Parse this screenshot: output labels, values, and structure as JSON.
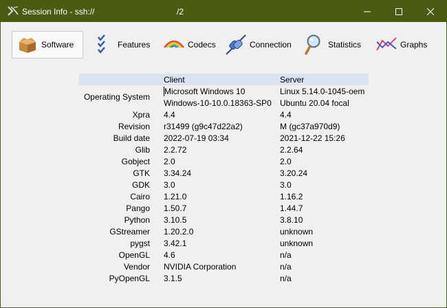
{
  "window": {
    "title": "Session Info - ssh://",
    "title_suffix": "/2",
    "controls": {
      "minimize": "minimize",
      "maximize": "maximize",
      "close": "close"
    }
  },
  "toolbar": {
    "items": [
      {
        "label": "Software",
        "icon": "box-icon",
        "active": true
      },
      {
        "label": "Features",
        "icon": "checklist-icon",
        "active": false
      },
      {
        "label": "Codecs",
        "icon": "rainbow-icon",
        "active": false
      },
      {
        "label": "Connection",
        "icon": "plug-icon",
        "active": false
      },
      {
        "label": "Statistics",
        "icon": "magnifier-icon",
        "active": false
      },
      {
        "label": "Graphs",
        "icon": "line-graph-icon",
        "active": false
      }
    ]
  },
  "table": {
    "headers": {
      "client": "Client",
      "server": "Server"
    },
    "rows": [
      {
        "label": "Operating System",
        "client": "Microsoft Windows 10",
        "client2": "Windows-10-10.0.18363-SP0",
        "server": "Linux 5.14.0-1045-oem",
        "server2": "Ubuntu 20.04 focal"
      },
      {
        "label": "Xpra",
        "client": "4.4",
        "server": "4.4"
      },
      {
        "label": "Revision",
        "client": "r31499 (g9c47d22a2)",
        "server": "M (gc37a970d9)"
      },
      {
        "label": "Build date",
        "client": "2022-07-19 03:34",
        "server": "2021-12-22 15:26"
      },
      {
        "label": "Glib",
        "client": "2.2.72",
        "server": "2.2.64"
      },
      {
        "label": "Gobject",
        "client": "2.0",
        "server": "2.0"
      },
      {
        "label": "GTK",
        "client": "3.34.24",
        "server": "3.20.24"
      },
      {
        "label": "GDK",
        "client": "3.0",
        "server": "3.0"
      },
      {
        "label": "Cairo",
        "client": "1.21.0",
        "server": "1.16.2"
      },
      {
        "label": "Pango",
        "client": "1.50.7",
        "server": "1.44.7"
      },
      {
        "label": "Python",
        "client": "3.10.5",
        "server": "3.8.10"
      },
      {
        "label": "GStreamer",
        "client": "1.20.2.0",
        "server": "unknown"
      },
      {
        "label": "pygst",
        "client": "3.42.1",
        "server": "unknown"
      },
      {
        "label": "OpenGL",
        "client": "4.6",
        "server": "n/a"
      },
      {
        "label": "Vendor",
        "client": "NVIDIA Corporation",
        "server": "n/a"
      },
      {
        "label": "PyOpenGL",
        "client": "3.1.5",
        "server": "n/a"
      }
    ]
  }
}
